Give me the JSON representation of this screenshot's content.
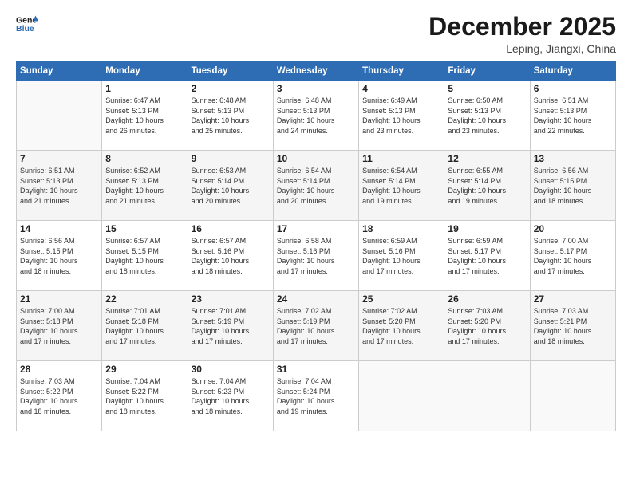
{
  "logo": {
    "line1": "General",
    "line2": "Blue"
  },
  "title": "December 2025",
  "location": "Leping, Jiangxi, China",
  "days_of_week": [
    "Sunday",
    "Monday",
    "Tuesday",
    "Wednesday",
    "Thursday",
    "Friday",
    "Saturday"
  ],
  "weeks": [
    [
      {
        "day": "",
        "info": ""
      },
      {
        "day": "1",
        "info": "Sunrise: 6:47 AM\nSunset: 5:13 PM\nDaylight: 10 hours\nand 26 minutes."
      },
      {
        "day": "2",
        "info": "Sunrise: 6:48 AM\nSunset: 5:13 PM\nDaylight: 10 hours\nand 25 minutes."
      },
      {
        "day": "3",
        "info": "Sunrise: 6:48 AM\nSunset: 5:13 PM\nDaylight: 10 hours\nand 24 minutes."
      },
      {
        "day": "4",
        "info": "Sunrise: 6:49 AM\nSunset: 5:13 PM\nDaylight: 10 hours\nand 23 minutes."
      },
      {
        "day": "5",
        "info": "Sunrise: 6:50 AM\nSunset: 5:13 PM\nDaylight: 10 hours\nand 23 minutes."
      },
      {
        "day": "6",
        "info": "Sunrise: 6:51 AM\nSunset: 5:13 PM\nDaylight: 10 hours\nand 22 minutes."
      }
    ],
    [
      {
        "day": "7",
        "info": "Sunrise: 6:51 AM\nSunset: 5:13 PM\nDaylight: 10 hours\nand 21 minutes."
      },
      {
        "day": "8",
        "info": "Sunrise: 6:52 AM\nSunset: 5:13 PM\nDaylight: 10 hours\nand 21 minutes."
      },
      {
        "day": "9",
        "info": "Sunrise: 6:53 AM\nSunset: 5:14 PM\nDaylight: 10 hours\nand 20 minutes."
      },
      {
        "day": "10",
        "info": "Sunrise: 6:54 AM\nSunset: 5:14 PM\nDaylight: 10 hours\nand 20 minutes."
      },
      {
        "day": "11",
        "info": "Sunrise: 6:54 AM\nSunset: 5:14 PM\nDaylight: 10 hours\nand 19 minutes."
      },
      {
        "day": "12",
        "info": "Sunrise: 6:55 AM\nSunset: 5:14 PM\nDaylight: 10 hours\nand 19 minutes."
      },
      {
        "day": "13",
        "info": "Sunrise: 6:56 AM\nSunset: 5:15 PM\nDaylight: 10 hours\nand 18 minutes."
      }
    ],
    [
      {
        "day": "14",
        "info": "Sunrise: 6:56 AM\nSunset: 5:15 PM\nDaylight: 10 hours\nand 18 minutes."
      },
      {
        "day": "15",
        "info": "Sunrise: 6:57 AM\nSunset: 5:15 PM\nDaylight: 10 hours\nand 18 minutes."
      },
      {
        "day": "16",
        "info": "Sunrise: 6:57 AM\nSunset: 5:16 PM\nDaylight: 10 hours\nand 18 minutes."
      },
      {
        "day": "17",
        "info": "Sunrise: 6:58 AM\nSunset: 5:16 PM\nDaylight: 10 hours\nand 17 minutes."
      },
      {
        "day": "18",
        "info": "Sunrise: 6:59 AM\nSunset: 5:16 PM\nDaylight: 10 hours\nand 17 minutes."
      },
      {
        "day": "19",
        "info": "Sunrise: 6:59 AM\nSunset: 5:17 PM\nDaylight: 10 hours\nand 17 minutes."
      },
      {
        "day": "20",
        "info": "Sunrise: 7:00 AM\nSunset: 5:17 PM\nDaylight: 10 hours\nand 17 minutes."
      }
    ],
    [
      {
        "day": "21",
        "info": "Sunrise: 7:00 AM\nSunset: 5:18 PM\nDaylight: 10 hours\nand 17 minutes."
      },
      {
        "day": "22",
        "info": "Sunrise: 7:01 AM\nSunset: 5:18 PM\nDaylight: 10 hours\nand 17 minutes."
      },
      {
        "day": "23",
        "info": "Sunrise: 7:01 AM\nSunset: 5:19 PM\nDaylight: 10 hours\nand 17 minutes."
      },
      {
        "day": "24",
        "info": "Sunrise: 7:02 AM\nSunset: 5:19 PM\nDaylight: 10 hours\nand 17 minutes."
      },
      {
        "day": "25",
        "info": "Sunrise: 7:02 AM\nSunset: 5:20 PM\nDaylight: 10 hours\nand 17 minutes."
      },
      {
        "day": "26",
        "info": "Sunrise: 7:03 AM\nSunset: 5:20 PM\nDaylight: 10 hours\nand 17 minutes."
      },
      {
        "day": "27",
        "info": "Sunrise: 7:03 AM\nSunset: 5:21 PM\nDaylight: 10 hours\nand 18 minutes."
      }
    ],
    [
      {
        "day": "28",
        "info": "Sunrise: 7:03 AM\nSunset: 5:22 PM\nDaylight: 10 hours\nand 18 minutes."
      },
      {
        "day": "29",
        "info": "Sunrise: 7:04 AM\nSunset: 5:22 PM\nDaylight: 10 hours\nand 18 minutes."
      },
      {
        "day": "30",
        "info": "Sunrise: 7:04 AM\nSunset: 5:23 PM\nDaylight: 10 hours\nand 18 minutes."
      },
      {
        "day": "31",
        "info": "Sunrise: 7:04 AM\nSunset: 5:24 PM\nDaylight: 10 hours\nand 19 minutes."
      },
      {
        "day": "",
        "info": ""
      },
      {
        "day": "",
        "info": ""
      },
      {
        "day": "",
        "info": ""
      }
    ]
  ]
}
